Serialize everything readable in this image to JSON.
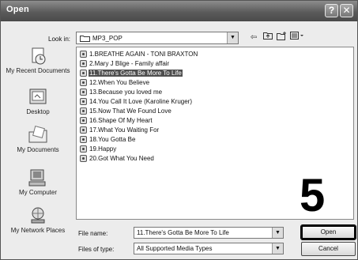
{
  "window": {
    "title": "Open",
    "help_label": "?",
    "close_label": "✕"
  },
  "lookin": {
    "label": "Look in:",
    "value": "MP3_POP"
  },
  "toolbar": {
    "back_icon": "⇦",
    "up_icon": "↑",
    "new_folder_icon": "✦",
    "views_icon": "☰"
  },
  "places": [
    {
      "label": "My Recent Documents",
      "icon": "recent-documents-icon"
    },
    {
      "label": "Desktop",
      "icon": "desktop-icon"
    },
    {
      "label": "My Documents",
      "icon": "my-documents-icon"
    },
    {
      "label": "My Computer",
      "icon": "my-computer-icon"
    },
    {
      "label": "My Network Places",
      "icon": "network-places-icon"
    }
  ],
  "files": [
    {
      "name": "1.BREATHE AGAIN - TONI BRAXTON",
      "selected": false
    },
    {
      "name": "2.Mary J Blige - Family affair",
      "selected": false
    },
    {
      "name": "11.There's Gotta Be More To Life",
      "selected": true
    },
    {
      "name": "12.When You Believe",
      "selected": false
    },
    {
      "name": "13.Because you loved me",
      "selected": false
    },
    {
      "name": "14.You Call It Love (Karoline Kruger)",
      "selected": false
    },
    {
      "name": "15.Now That We Found Love",
      "selected": false
    },
    {
      "name": "16.Shape Of My Heart",
      "selected": false
    },
    {
      "name": "17.What You Waiting For",
      "selected": false
    },
    {
      "name": "18.You Gotta Be",
      "selected": false
    },
    {
      "name": "19.Happy",
      "selected": false
    },
    {
      "name": "20.Got What You Need",
      "selected": false
    }
  ],
  "filename": {
    "label": "File name:",
    "value": "11.There's Gotta Be More To Life"
  },
  "filetype": {
    "label": "Files of type:",
    "value": "All Supported Media Types"
  },
  "buttons": {
    "open": "Open",
    "cancel": "Cancel"
  },
  "callout": "5",
  "colors": {
    "selection": "#4e4e4e",
    "titlebar": "#5b5b5b"
  }
}
